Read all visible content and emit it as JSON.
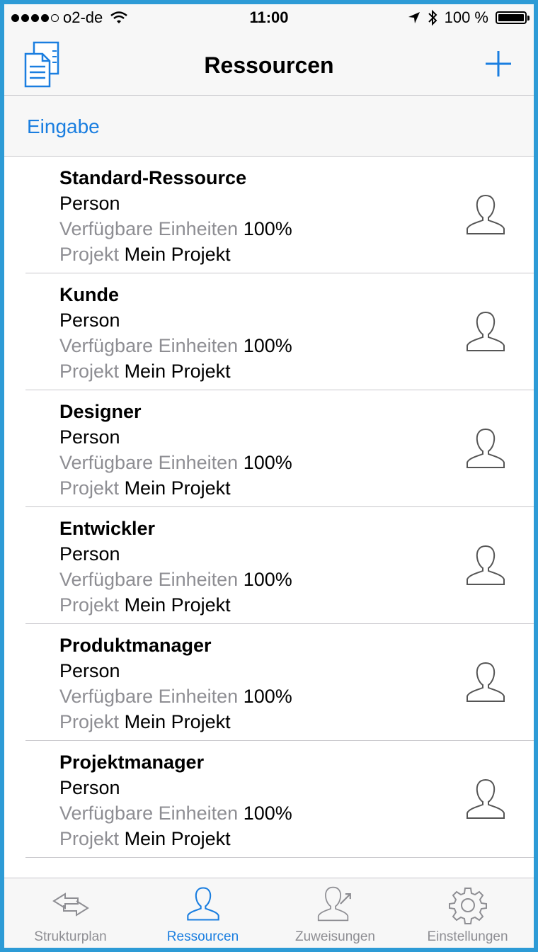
{
  "status_bar": {
    "carrier": "o2-de",
    "time": "11:00",
    "battery": "100 %"
  },
  "navbar": {
    "title": "Ressourcen"
  },
  "section": {
    "label": "Eingabe"
  },
  "resources": [
    {
      "name": "Standard-Ressource",
      "type": "Person",
      "units_label": "Verfügbare Einheiten",
      "units_value": "100%",
      "project_label": "Projekt",
      "project_value": "Mein Projekt"
    },
    {
      "name": "Kunde",
      "type": "Person",
      "units_label": "Verfügbare Einheiten",
      "units_value": "100%",
      "project_label": "Projekt",
      "project_value": "Mein Projekt"
    },
    {
      "name": "Designer",
      "type": "Person",
      "units_label": "Verfügbare Einheiten",
      "units_value": "100%",
      "project_label": "Projekt",
      "project_value": "Mein Projekt"
    },
    {
      "name": "Entwickler",
      "type": "Person",
      "units_label": "Verfügbare Einheiten",
      "units_value": "100%",
      "project_label": "Projekt",
      "project_value": "Mein Projekt"
    },
    {
      "name": "Produktmanager",
      "type": "Person",
      "units_label": "Verfügbare Einheiten",
      "units_value": "100%",
      "project_label": "Projekt",
      "project_value": "Mein Projekt"
    },
    {
      "name": "Projektmanager",
      "type": "Person",
      "units_label": "Verfügbare Einheiten",
      "units_value": "100%",
      "project_label": "Projekt",
      "project_value": "Mein Projekt"
    }
  ],
  "tabs": [
    {
      "label": "Strukturplan",
      "icon": "arrows-icon"
    },
    {
      "label": "Ressourcen",
      "icon": "person-icon",
      "active": true
    },
    {
      "label": "Zuweisungen",
      "icon": "person-share-icon"
    },
    {
      "label": "Einstellungen",
      "icon": "gear-icon"
    }
  ],
  "colors": {
    "accent": "#1a7ee0",
    "muted": "#8e8e93",
    "frame": "#2d9bd6"
  }
}
